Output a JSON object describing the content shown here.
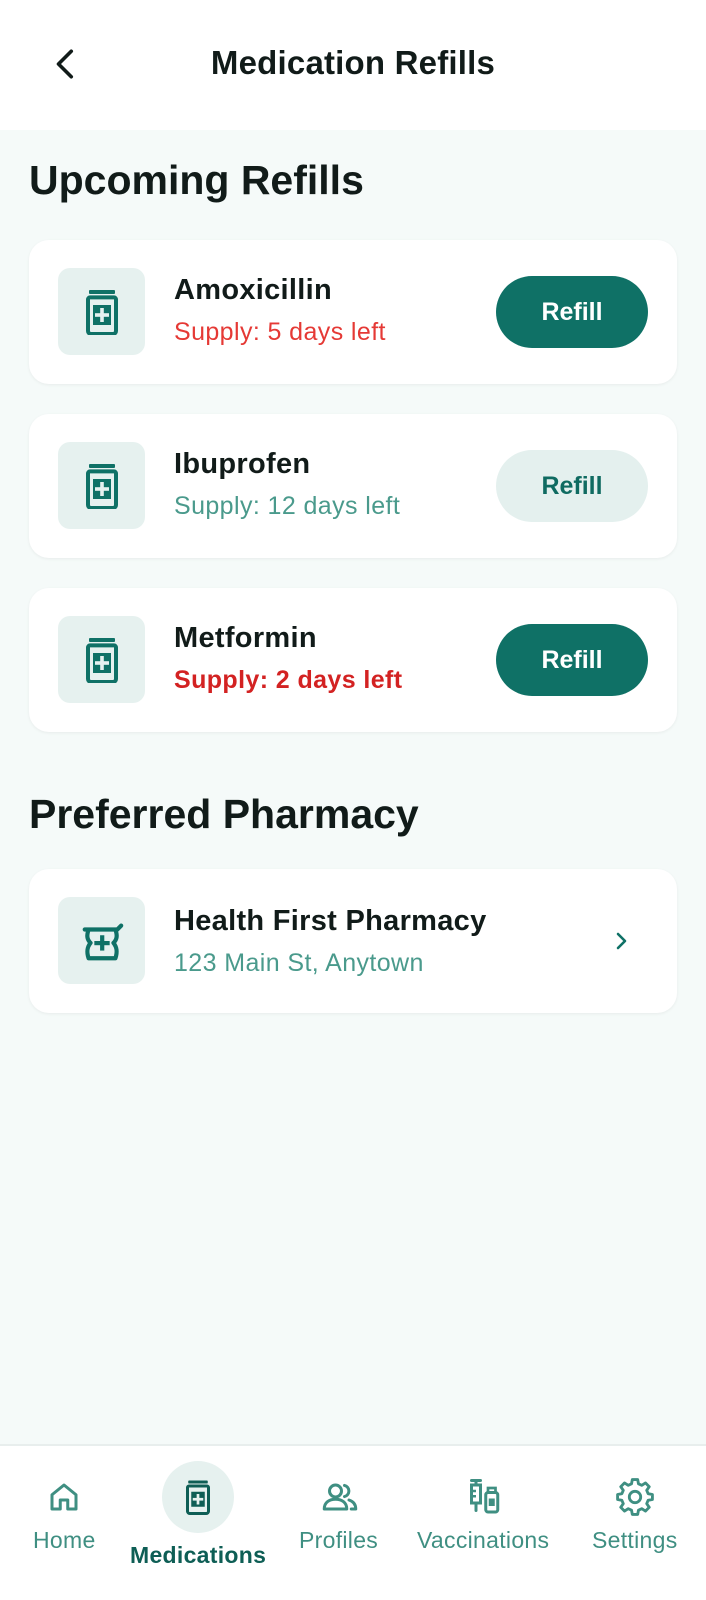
{
  "header": {
    "title": "Medication Refills",
    "back_icon": "chevron-left-icon"
  },
  "upcoming": {
    "title": "Upcoming Refills",
    "items": [
      {
        "name": "Amoxicillin",
        "supply": "Supply: 5 days left",
        "button": "Refill",
        "icon": "medicine-bottle-icon"
      },
      {
        "name": "Ibuprofen",
        "supply": "Supply: 12 days left",
        "button": "Refill",
        "icon": "medicine-bottle-icon"
      },
      {
        "name": "Metformin",
        "supply": "Supply: 2 days left",
        "button": "Refill",
        "icon": "medicine-bottle-icon"
      }
    ]
  },
  "pharmacy": {
    "title": "Preferred Pharmacy",
    "name": "Health First Pharmacy",
    "address": "123 Main St, Anytown",
    "icon": "mortar-pestle-icon"
  },
  "nav": {
    "items": [
      {
        "label": "Home",
        "icon": "home-icon"
      },
      {
        "label": "Medications",
        "icon": "medicine-bottle-icon",
        "active": true
      },
      {
        "label": "Profiles",
        "icon": "people-icon"
      },
      {
        "label": "Vaccinations",
        "icon": "syringe-icon"
      },
      {
        "label": "Settings",
        "icon": "gear-icon"
      }
    ]
  },
  "colors": {
    "primary": "#0f7166",
    "secondary_bg": "#e4f0ee",
    "warning": "#e53935",
    "critical": "#d32222",
    "muted_teal": "#4a9a8c",
    "page_bg": "#f5faf9"
  }
}
